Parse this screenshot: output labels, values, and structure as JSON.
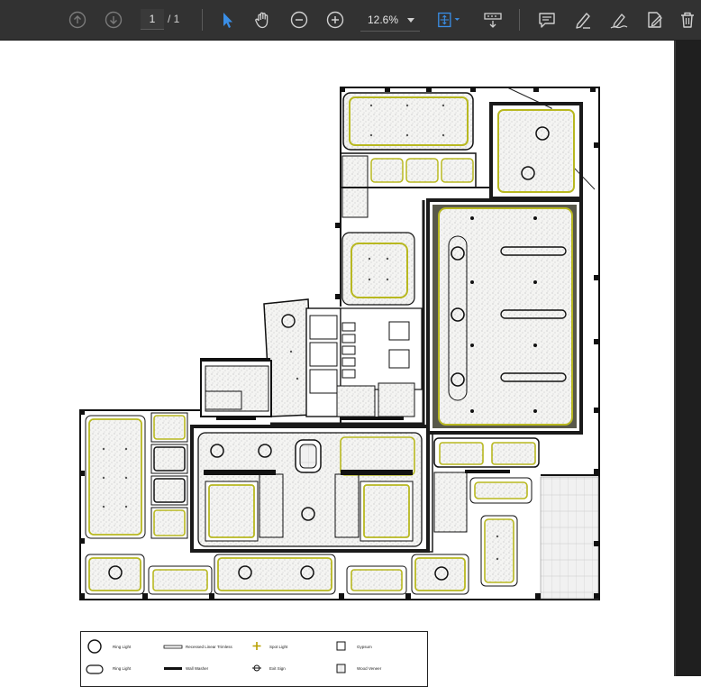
{
  "toolbar": {
    "page_current": "1",
    "page_total": "/ 1",
    "zoom_value": "12.6%",
    "colors": {
      "background": "#323232",
      "icon": "#c8c8c8",
      "active_tool": "#3a8ee6"
    },
    "icons": [
      "arrow-up-icon",
      "arrow-down-icon",
      "select-cursor-icon",
      "hand-tool-icon",
      "zoom-out-icon",
      "zoom-in-icon",
      "fit-page-icon",
      "read-mode-icon",
      "comment-icon",
      "highlight-pen-icon",
      "sign-icon",
      "edit-pdf-icon",
      "delete-icon"
    ]
  },
  "legend": {
    "items": [
      "Ring Light",
      "Recessed Linear Trimless",
      "Spot Light",
      "Gypsum",
      "Ring Light",
      "Wall Washer",
      "Exit Sign",
      "Wood Veneer"
    ]
  }
}
